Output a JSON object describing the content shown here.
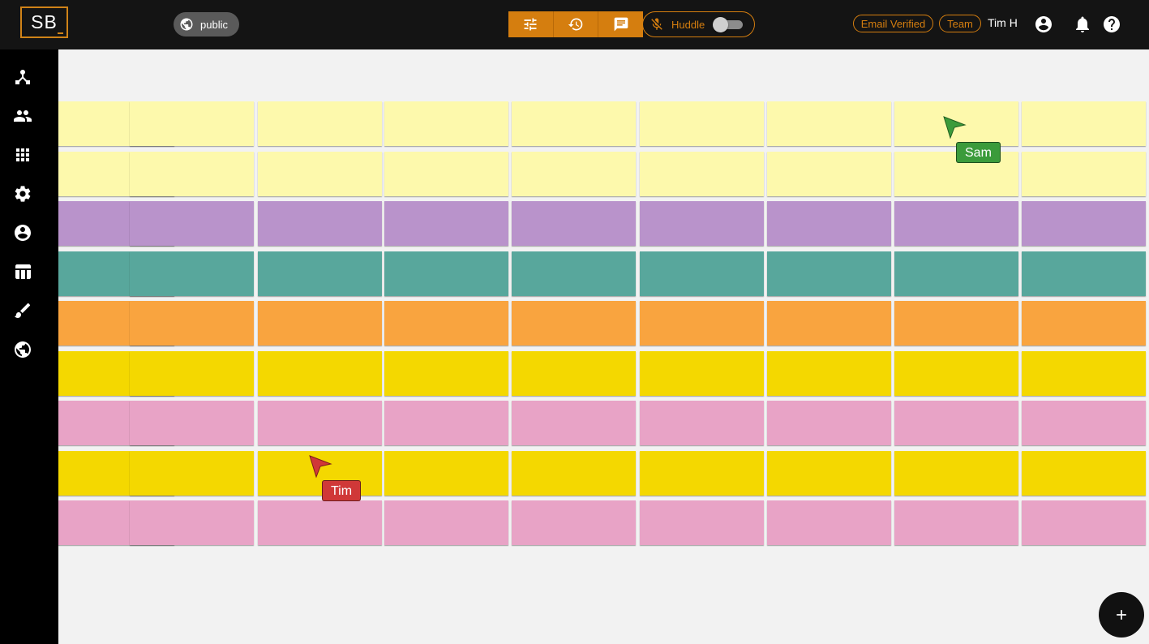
{
  "app": {
    "logo_text": "SB",
    "visibility_label": "public",
    "huddle_label": "Huddle",
    "huddle_enabled": false,
    "badges": [
      "Email Verified",
      "Team"
    ],
    "user_name": "Tim H"
  },
  "toolbar": {
    "buttons": [
      "tune-icon",
      "history-icon",
      "chat-icon"
    ]
  },
  "sidebar": {
    "items": [
      "network-icon",
      "people-icon",
      "grid-icon",
      "gear-icon",
      "account-icon",
      "table-icon",
      "brush-icon",
      "globe-icon"
    ]
  },
  "board": {
    "row_colors": [
      "#fdf9ac",
      "#fdf9ac",
      "#b993cb",
      "#58a79c",
      "#f9a43f",
      "#f4d800",
      "#e8a3c6",
      "#f4d800",
      "#e8a3c6"
    ],
    "columns": 9
  },
  "cursors": [
    {
      "name": "Sam",
      "color": "#3b9b3b"
    },
    {
      "name": "Tim",
      "color": "#d03838"
    }
  ],
  "colors": {
    "accent": "#d57e0f",
    "topbar": "#141414",
    "canvas": "#f2f2f2"
  }
}
